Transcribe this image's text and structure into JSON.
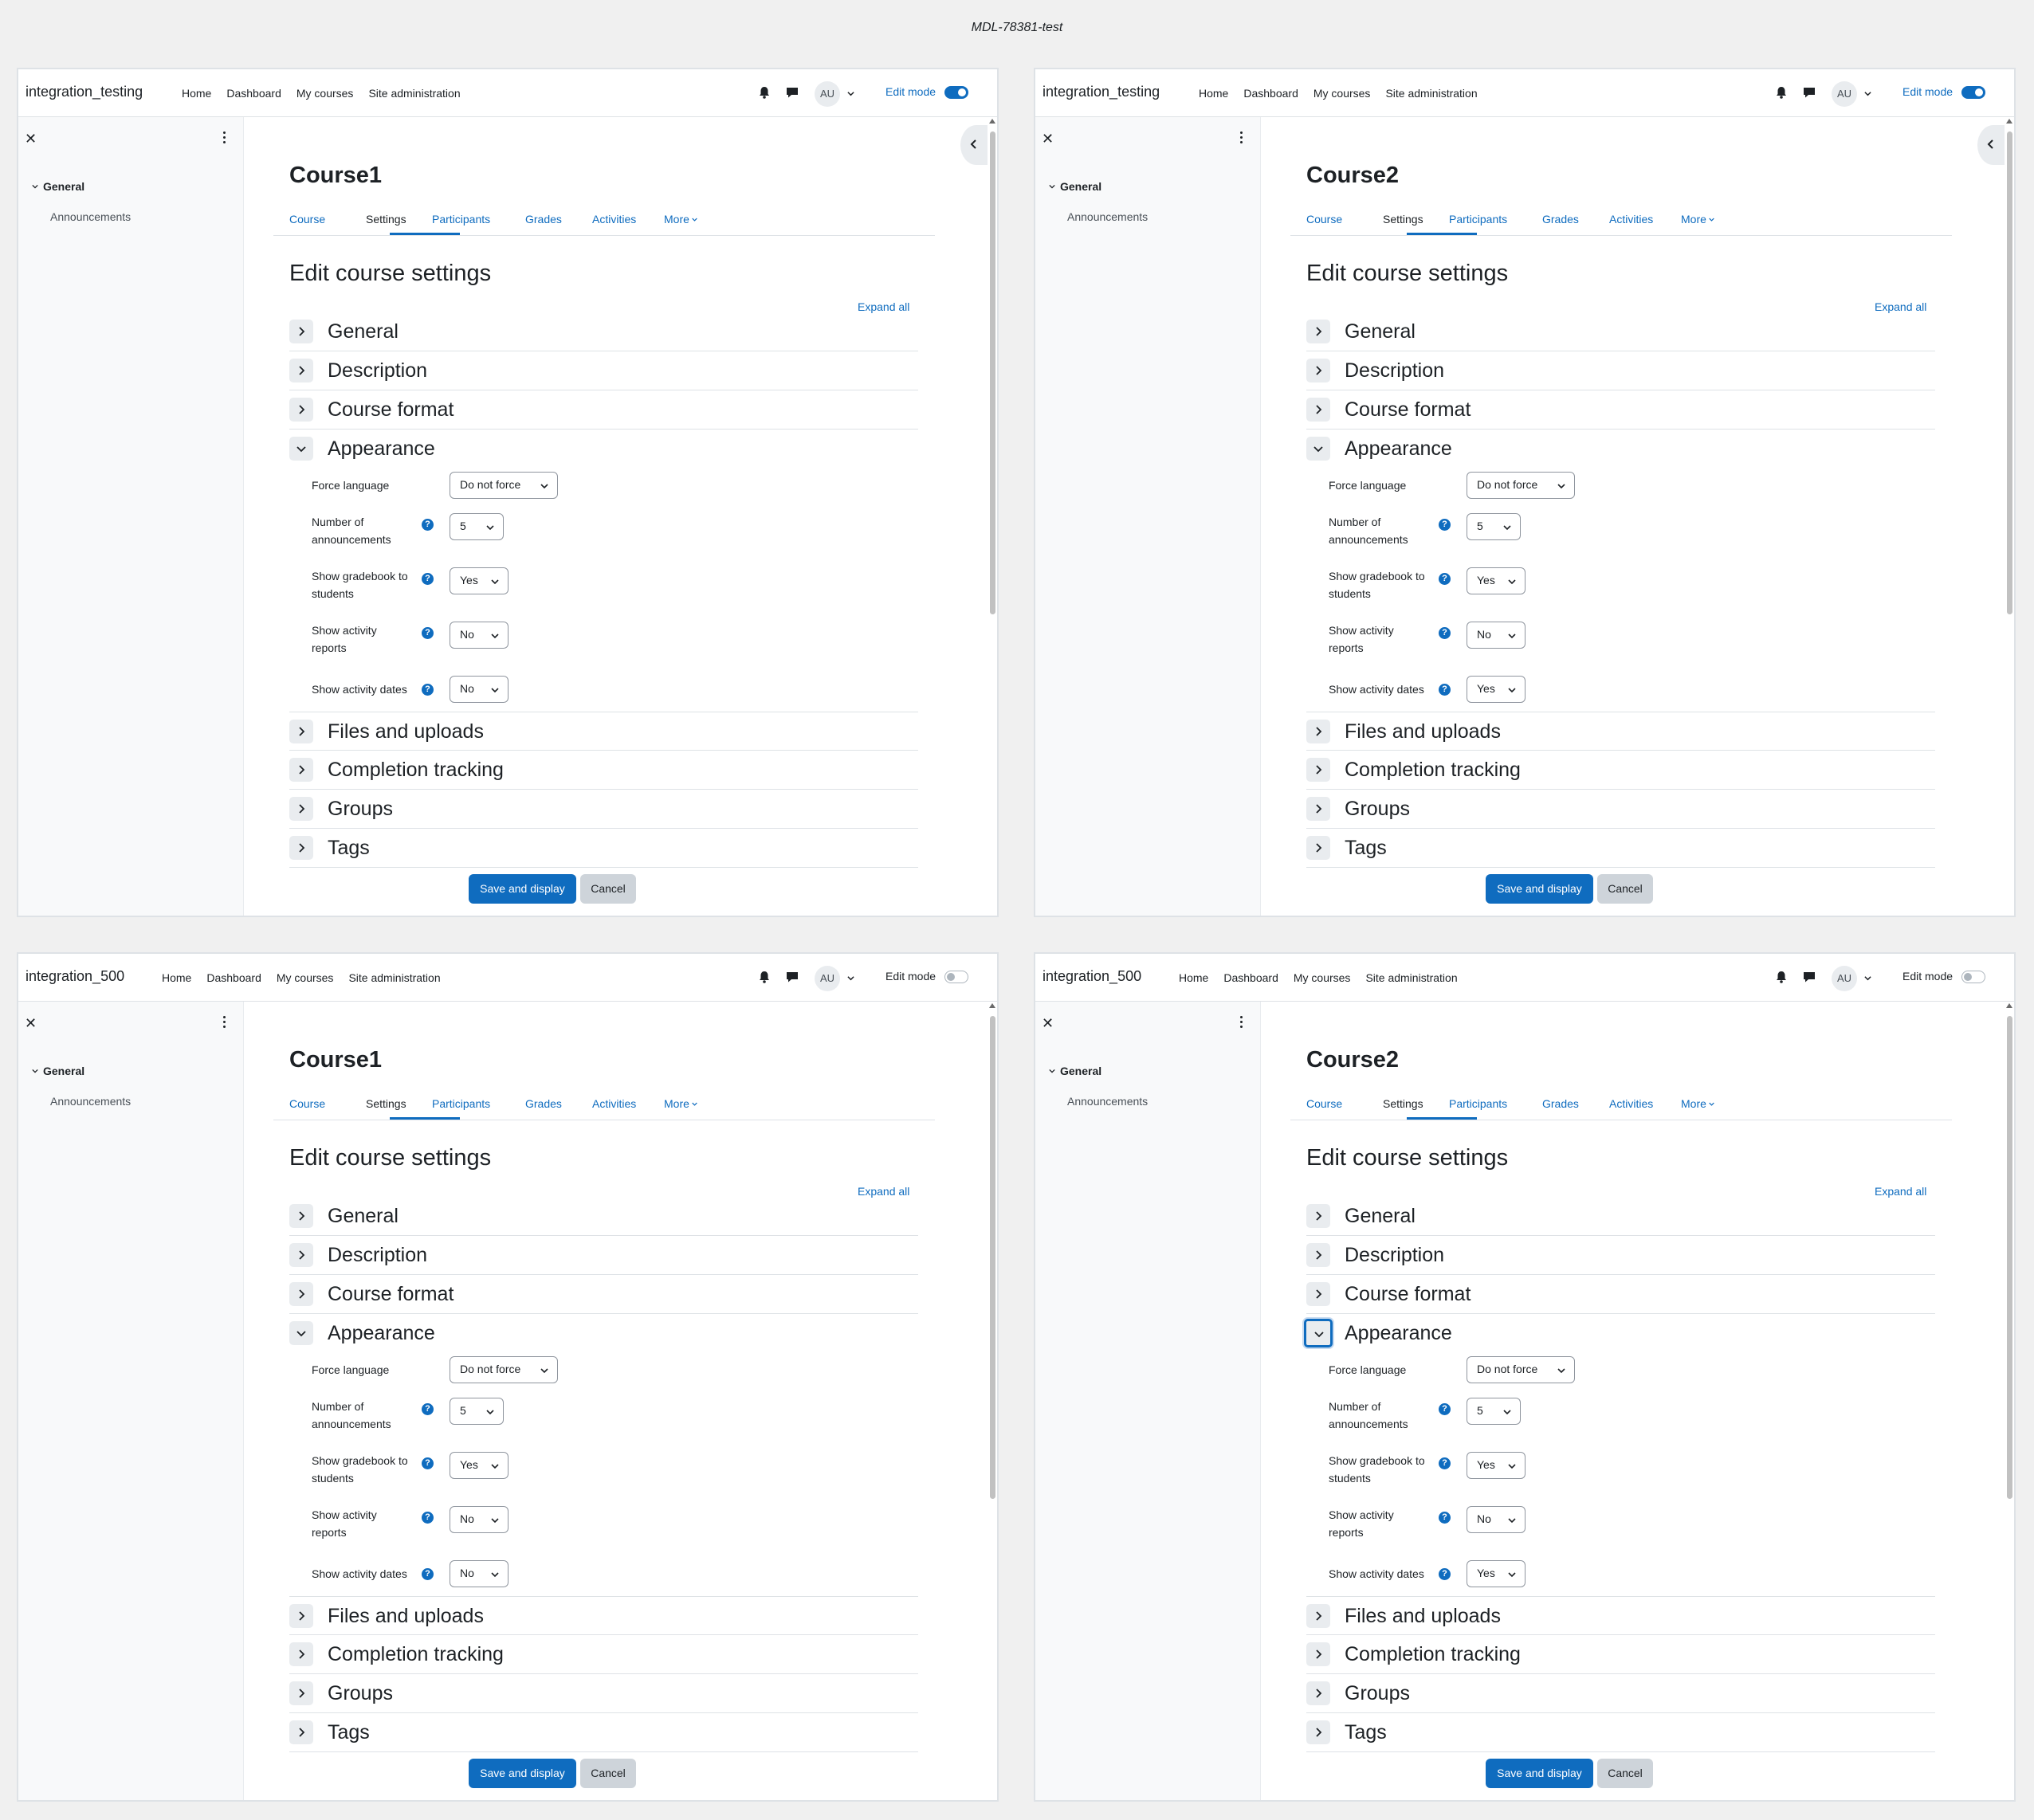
{
  "page_title": "MDL-78381-test",
  "nav": {
    "links": [
      "Home",
      "Dashboard",
      "My courses",
      "Site administration"
    ],
    "avatar": "AU",
    "edit_mode_label": "Edit mode"
  },
  "drawer": {
    "section": "General",
    "item": "Announcements"
  },
  "tabs": [
    "Course",
    "Settings",
    "Participants",
    "Grades",
    "Activities",
    "More"
  ],
  "edit_heading": "Edit course settings",
  "expand_all": "Expand all",
  "sections_top": [
    "General",
    "Description",
    "Course format",
    "Appearance"
  ],
  "sections_bottom": [
    "Files and uploads",
    "Completion tracking",
    "Groups",
    "Tags"
  ],
  "fields": {
    "force_language": "Force language",
    "num_announcements": [
      "Number of",
      "announcements"
    ],
    "show_gradebook": [
      "Show gradebook to",
      "students"
    ],
    "show_activity_reports": [
      "Show activity",
      "reports"
    ],
    "show_activity_dates": "Show activity dates",
    "help_glyph": "?"
  },
  "buttons": {
    "save": "Save and display",
    "cancel": "Cancel"
  },
  "panes": [
    {
      "site": "integration_testing",
      "course": "Course1",
      "edit_mode": true,
      "values": {
        "force_language": "Do not force",
        "num_announcements": "5",
        "show_gradebook": "Yes",
        "show_activity_reports": "No",
        "show_activity_dates": "No"
      }
    },
    {
      "site": "integration_testing",
      "course": "Course2",
      "edit_mode": true,
      "values": {
        "force_language": "Do not force",
        "num_announcements": "5",
        "show_gradebook": "Yes",
        "show_activity_reports": "No",
        "show_activity_dates": "Yes"
      }
    },
    {
      "site": "integration_500",
      "course": "Course1",
      "edit_mode": false,
      "values": {
        "force_language": "Do not force",
        "num_announcements": "5",
        "show_gradebook": "Yes",
        "show_activity_reports": "No",
        "show_activity_dates": "No"
      }
    },
    {
      "site": "integration_500",
      "course": "Course2",
      "edit_mode": false,
      "values": {
        "force_language": "Do not force",
        "num_announcements": "5",
        "show_gradebook": "Yes",
        "show_activity_reports": "No",
        "show_activity_dates": "Yes"
      }
    }
  ],
  "colors": {
    "accent": "#0f6cbf",
    "text": "#1d2125",
    "border": "#dee2e6"
  }
}
